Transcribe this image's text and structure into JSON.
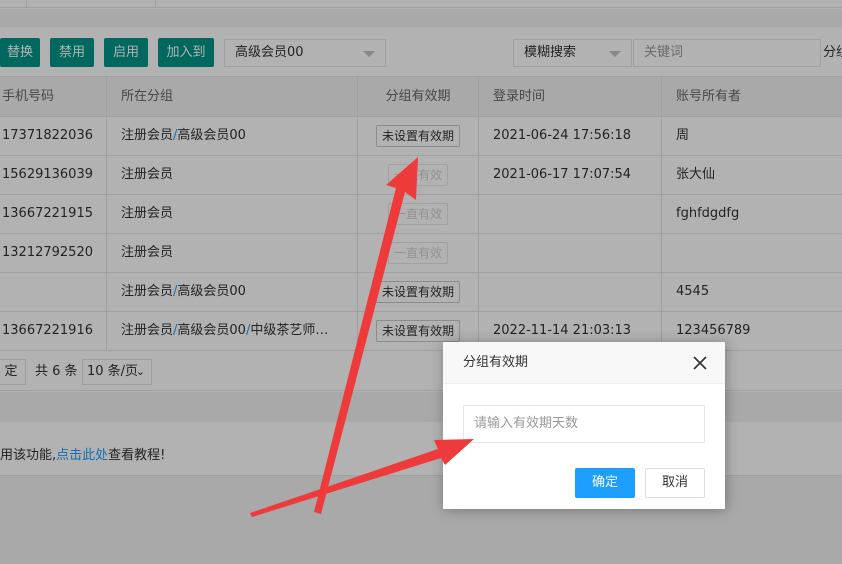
{
  "toolbar": {
    "buttons": [
      {
        "label": "替换"
      },
      {
        "label": "禁用"
      },
      {
        "label": "启用"
      },
      {
        "label": "加入到"
      }
    ],
    "group_select": "高级会员00",
    "search_mode_select": "模糊搜索",
    "keyword_placeholder": "关键词",
    "cut_label": "分组"
  },
  "table": {
    "headers": [
      "手机号码",
      "所在分组",
      "分组有效期",
      "登录时间",
      "账号所有者"
    ],
    "rows": [
      {
        "phone": "17371822036",
        "group": [
          "注册会员",
          "高级会员00"
        ],
        "validity": "未设置有效期",
        "validity_state": "active",
        "login": "2021-06-24 17:56:18",
        "owner": "周"
      },
      {
        "phone": "15629136039",
        "group": [
          "注册会员"
        ],
        "validity": "一直有效",
        "validity_state": "disabled",
        "login": "2021-06-17 17:07:54",
        "owner": "张大仙"
      },
      {
        "phone": "13667221915",
        "group": [
          "注册会员"
        ],
        "validity": "一直有效",
        "validity_state": "disabled",
        "login": "",
        "owner": "fghfdgdfg"
      },
      {
        "phone": "13212792520",
        "group": [
          "注册会员"
        ],
        "validity": "一直有效",
        "validity_state": "disabled",
        "login": "",
        "owner": ""
      },
      {
        "phone": "",
        "group": [
          "注册会员",
          "高级会员00"
        ],
        "validity": "未设置有效期",
        "validity_state": "active",
        "login": "",
        "owner": "4545"
      },
      {
        "phone": "13667221916",
        "group": [
          "注册会员",
          "高级会员00",
          "中级茶艺师…"
        ],
        "validity": "未设置有效期",
        "validity_state": "active",
        "login": "2022-11-14 21:03:13",
        "owner": "123456789"
      }
    ]
  },
  "pagination": {
    "confirm_label": "定",
    "total_label": "共 6 条",
    "page_size": "10 条/页"
  },
  "tip": {
    "prefix": "用该功能,",
    "link": "点击此处",
    "suffix": "查看教程!"
  },
  "dialog": {
    "title": "分组有效期",
    "input_placeholder": "请输入有效期天数",
    "ok_label": "确定",
    "cancel_label": "取消"
  },
  "colors": {
    "toolbar_button": "#009688",
    "primary_button": "#1e9fff",
    "link": "#1e9fff",
    "annotation_arrow": "#ee3a3a"
  }
}
